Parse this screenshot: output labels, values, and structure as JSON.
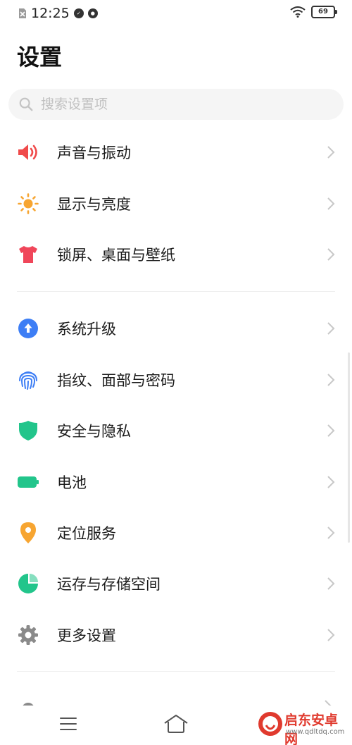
{
  "status_bar": {
    "time": "12:25",
    "battery": "69",
    "icons": [
      "sim-off-icon",
      "notification-icon",
      "notification-icon-2",
      "wifi-icon",
      "battery-icon"
    ]
  },
  "header": {
    "title": "设置"
  },
  "search": {
    "placeholder": "搜索设置项"
  },
  "groups": [
    {
      "items": [
        {
          "label": "声音与振动",
          "icon": "speaker-icon",
          "color": "#f04a4a"
        },
        {
          "label": "显示与亮度",
          "icon": "sun-icon",
          "color": "#f7a531"
        },
        {
          "label": "锁屏、桌面与壁纸",
          "icon": "tshirt-icon",
          "color": "#f0465a"
        }
      ]
    },
    {
      "items": [
        {
          "label": "系统升级",
          "icon": "upgrade-arrow-icon",
          "color": "#3d7ef5"
        },
        {
          "label": "指纹、面部与密码",
          "icon": "fingerprint-icon",
          "color": "#3d7ef5"
        },
        {
          "label": "安全与隐私",
          "icon": "shield-icon",
          "color": "#22c58b"
        },
        {
          "label": "电池",
          "icon": "battery-icon",
          "color": "#22c58b"
        },
        {
          "label": "定位服务",
          "icon": "location-pin-icon",
          "color": "#f7a531"
        },
        {
          "label": "运存与存储空间",
          "icon": "pie-chart-icon",
          "color": "#22c58b"
        },
        {
          "label": "更多设置",
          "icon": "gear-icon",
          "color": "#8a8a8a"
        }
      ]
    }
  ],
  "nav_bar": {
    "icons": [
      "menu-icon",
      "home-icon"
    ]
  },
  "watermark": {
    "name": "启东安卓网",
    "url": "www.qdltdq.com"
  }
}
